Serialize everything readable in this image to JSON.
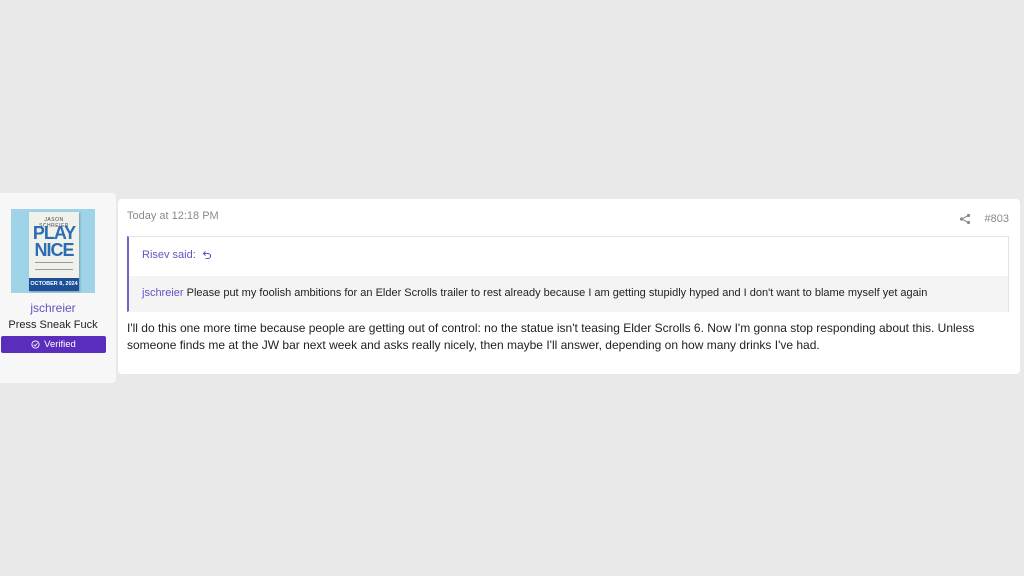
{
  "user": {
    "name": "jschreier",
    "title": "Press Sneak Fuck",
    "badge": "Verified",
    "avatar_book": {
      "author": "JASON SCHREIER",
      "title_line1": "PLAY",
      "title_line2": "NICE",
      "date": "OCTOBER 8, 2024"
    }
  },
  "post": {
    "timestamp": "Today at 12:18 PM",
    "number": "#803",
    "quote": {
      "author_label": "Risev said:",
      "mention": "jschreier",
      "text": " Please put my foolish ambitions for an Elder Scrolls trailer to rest already because I am getting stupidly hyped and I don't want to blame myself yet again"
    },
    "body": "I'll do this one more time because people are getting out of control: no the statue isn't teasing Elder Scrolls 6. Now I'm gonna stop responding about this. Unless someone finds me at the JW bar next week and asks really nicely, then maybe I'll answer, depending on how many drinks I've had."
  },
  "colors": {
    "accent": "#6a4fc2",
    "badge_bg": "#5b2dbd",
    "page_bg": "#e9e9e9"
  }
}
